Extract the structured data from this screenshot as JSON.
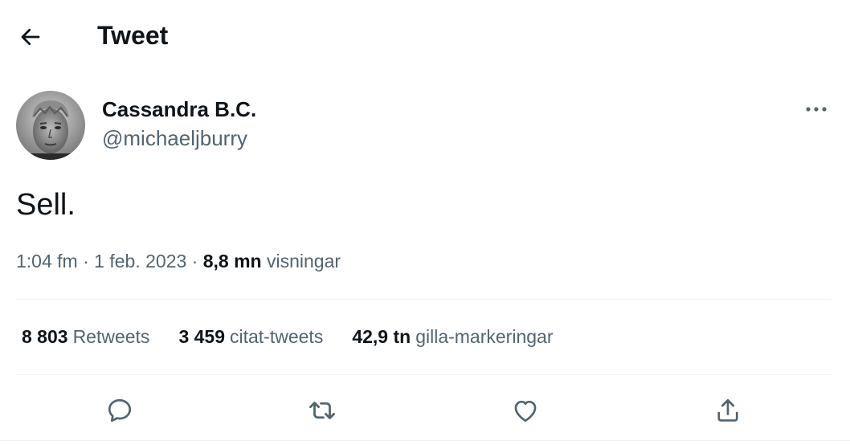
{
  "header": {
    "title": "Tweet",
    "back_icon": "arrow-left-icon"
  },
  "author": {
    "display_name": "Cassandra B.C.",
    "handle": "@michaeljburry",
    "more_icon": "more-horizontal-icon"
  },
  "tweet": {
    "text": "Sell."
  },
  "meta": {
    "time": "1:04 fm",
    "separator": "·",
    "date": "1 feb. 2023",
    "views_count": "8,8 mn",
    "views_label": "visningar"
  },
  "stats": {
    "retweets_count": "8 803",
    "retweets_label": "Retweets",
    "quotes_count": "3 459",
    "quotes_label": "citat-tweets",
    "likes_count": "42,9 tn",
    "likes_label": "gilla-markeringar"
  },
  "actions": {
    "reply_icon": "reply-icon",
    "retweet_icon": "retweet-icon",
    "like_icon": "heart-icon",
    "share_icon": "share-icon"
  },
  "colors": {
    "text_primary": "#0f1419",
    "text_secondary": "#536471",
    "divider": "#eff3f4"
  }
}
